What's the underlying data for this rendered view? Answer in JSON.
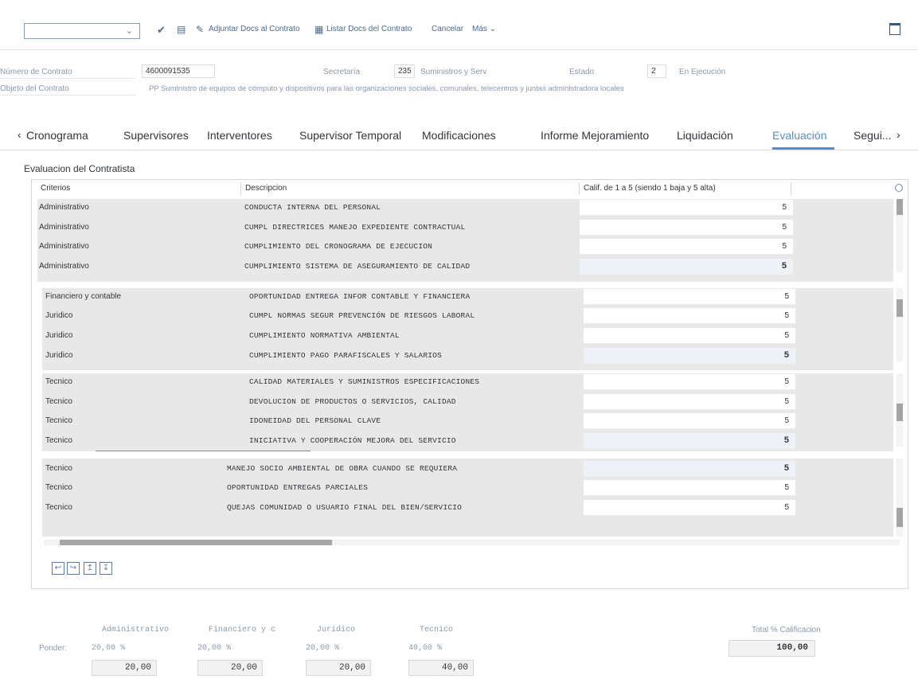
{
  "toolbar": {
    "select_value": "",
    "adjuntar_label": "Adjuntar Docs al Contrato",
    "listar_label": "Listar Docs del Contrato",
    "cancelar_label": "Cancelar",
    "mas_label": "Más"
  },
  "header": {
    "numero_label": "Número de Contrato",
    "numero_value": "4600091535",
    "secretaria_label": "Secretaría",
    "secretaria_code": "235",
    "secretaria_text": "Suministros y Serv",
    "estado_label": "Estado",
    "estado_code": "2",
    "estado_text": "En Ejecución",
    "objeto_label": "Objeto del Contrato",
    "objeto_value": "PP Suministro de equipos de cómputo y dispositivos para las organizaciones sociales, comunales, telecentros y juntas administradora locales"
  },
  "tabs": [
    {
      "label": "Cronograma"
    },
    {
      "label": "Supervisores"
    },
    {
      "label": "Interventores"
    },
    {
      "label": "Supervisor Temporal"
    },
    {
      "label": "Modificaciones"
    },
    {
      "label": "Informe Mejoramiento"
    },
    {
      "label": "Liquidación"
    },
    {
      "label": "Evaluación"
    },
    {
      "label": "Segui..."
    }
  ],
  "section_title": "Evaluacion del Contratista",
  "table": {
    "col_criterios": "Criterios",
    "col_descripcion": "Descripcion",
    "col_calif": "Calif. de 1 a 5 (siendo 1 baja y 5 alta)",
    "rows": [
      {
        "criterio": "Administrativo",
        "descripcion": "CONDUCTA INTERNA DEL PERSONAL",
        "calif": "5"
      },
      {
        "criterio": "Administrativo",
        "descripcion": "CUMPL DIRECTRICES MANEJO EXPEDIENTE CONTRACTUAL",
        "calif": "5"
      },
      {
        "criterio": "Administrativo",
        "descripcion": "CUMPLIMIENTO DEL CRONOGRAMA DE EJECUCION",
        "calif": "5"
      },
      {
        "criterio": "Administrativo",
        "descripcion": "CUMPLIMIENTO SISTEMA DE ASEGURAMIENTO DE CALIDAD",
        "calif": "5"
      },
      {
        "criterio": "Financiero y contable",
        "descripcion": "OPORTUNIDAD ENTREGA INFOR CONTABLE Y FINANCIERA",
        "calif": "5"
      },
      {
        "criterio": "Juridico",
        "descripcion": "CUMPL NORMAS SEGUR PREVENCIÓN DE RIESGOS LABORAL",
        "calif": "5"
      },
      {
        "criterio": "Juridico",
        "descripcion": "CUMPLIMIENTO NORMATIVA AMBIENTAL",
        "calif": "5"
      },
      {
        "criterio": "Juridico",
        "descripcion": "CUMPLIMIENTO PAGO PARAFISCALES Y SALARIOS",
        "calif": "5"
      },
      {
        "criterio": "Tecnico",
        "descripcion": "CALIDAD MATERIALES Y SUMINISTROS ESPECIFICACIONES",
        "calif": "5"
      },
      {
        "criterio": "Tecnico",
        "descripcion": "DEVOLUCION DE PRODUCTOS O SERVICIOS, CALIDAD",
        "calif": "5"
      },
      {
        "criterio": "Tecnico",
        "descripcion": "IDONEIDAD DEL PERSONAL CLAVE",
        "calif": "5"
      },
      {
        "criterio": "Tecnico",
        "descripcion": "INICIATIVA Y COOPERACIÓN MEJORA DEL SERVICIO",
        "calif": "5"
      },
      {
        "criterio": "Tecnico",
        "descripcion": "MANEJO SOCIO AMBIENTAL DE OBRA CUANDO SE REQUIERA",
        "calif": "5"
      },
      {
        "criterio": "Tecnico",
        "descripcion": "OPORTUNIDAD ENTREGAS PARCIALES",
        "calif": "5"
      },
      {
        "criterio": "Tecnico",
        "descripcion": "QUEJAS COMUNIDAD O USUARIO FINAL DEL BIEN/SERVICIO",
        "calif": "5"
      }
    ]
  },
  "totals": {
    "label_ponder": "Ponder:",
    "heads": [
      "Administrativo",
      "Financiero y c",
      "Juridico",
      "Tecnico"
    ],
    "pcts": [
      "20,00  %",
      "20,00  %",
      "20,00  %",
      "40,00  %"
    ],
    "values": [
      "20,00",
      "20,00",
      "20,00",
      "40,00"
    ],
    "total_label": "Total % Calificacion",
    "total_value": "100,00"
  }
}
